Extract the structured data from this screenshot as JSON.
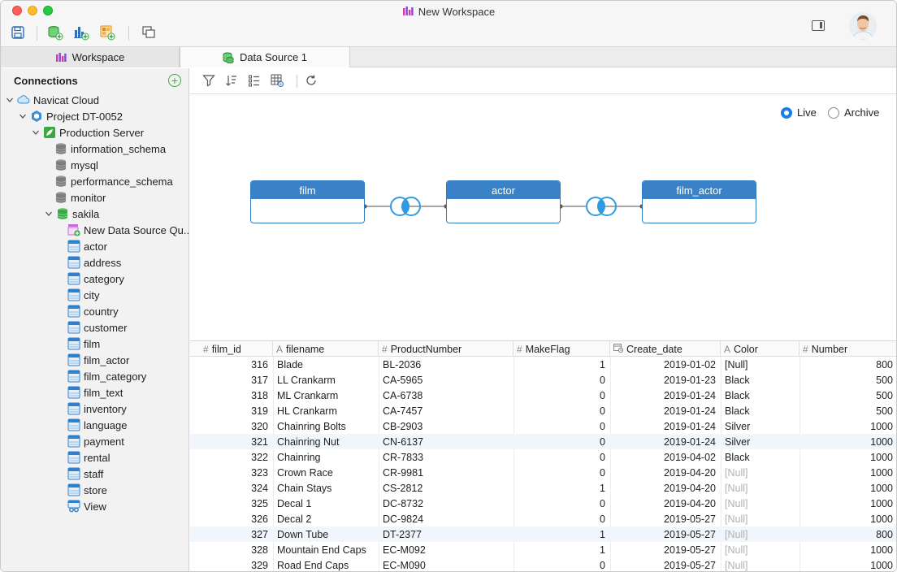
{
  "window": {
    "title": "New Workspace"
  },
  "toolbar": {
    "save_icon": "save-icon",
    "new_datasource_icon": "new-datasource-icon",
    "new_chart_icon": "new-chart-icon",
    "new_dashboard_icon": "new-dashboard-icon",
    "windows_icon": "windows-icon"
  },
  "tabs": [
    {
      "label": "Workspace",
      "icon": "workspace-icon"
    },
    {
      "label": "Data Source 1",
      "icon": "datasource-icon"
    }
  ],
  "sidebar": {
    "heading": "Connections",
    "add_symbol": "+",
    "tree": [
      {
        "label": "Navicat Cloud",
        "icon": "cloud-icon",
        "level": 0,
        "chevron": "open"
      },
      {
        "label": "Project DT-0052",
        "icon": "project-icon",
        "level": 1,
        "chevron": "open"
      },
      {
        "label": "Production Server",
        "icon": "server-icon",
        "level": 2,
        "chevron": "open"
      },
      {
        "label": "information_schema",
        "icon": "database-icon",
        "level": 3
      },
      {
        "label": "mysql",
        "icon": "database-icon",
        "level": 3
      },
      {
        "label": "performance_schema",
        "icon": "database-icon",
        "level": 3
      },
      {
        "label": "monitor",
        "icon": "database-icon",
        "level": 3
      },
      {
        "label": "sakila",
        "icon": "database-open-icon",
        "level": 3,
        "chevron": "open"
      },
      {
        "label": "New Data Source Qu...",
        "icon": "new-query-icon",
        "level": 4
      },
      {
        "label": "actor",
        "icon": "table-icon",
        "level": 4
      },
      {
        "label": "address",
        "icon": "table-icon",
        "level": 4
      },
      {
        "label": "category",
        "icon": "table-icon",
        "level": 4
      },
      {
        "label": "city",
        "icon": "table-icon",
        "level": 4
      },
      {
        "label": "country",
        "icon": "table-icon",
        "level": 4
      },
      {
        "label": "customer",
        "icon": "table-icon",
        "level": 4
      },
      {
        "label": "film",
        "icon": "table-icon",
        "level": 4
      },
      {
        "label": "film_actor",
        "icon": "table-icon",
        "level": 4
      },
      {
        "label": "film_category",
        "icon": "table-icon",
        "level": 4
      },
      {
        "label": "film_text",
        "icon": "table-icon",
        "level": 4
      },
      {
        "label": "inventory",
        "icon": "table-icon",
        "level": 4
      },
      {
        "label": "language",
        "icon": "table-icon",
        "level": 4
      },
      {
        "label": "payment",
        "icon": "table-icon",
        "level": 4
      },
      {
        "label": "rental",
        "icon": "table-icon",
        "level": 4
      },
      {
        "label": "staff",
        "icon": "table-icon",
        "level": 4
      },
      {
        "label": "store",
        "icon": "table-icon",
        "level": 4
      },
      {
        "label": "View",
        "icon": "view-icon",
        "level": 4
      }
    ]
  },
  "main_toolbar": {
    "filter_icon": "filter-icon",
    "sort_icon": "sort-icon",
    "fields_icon": "fields-icon",
    "table_settings_icon": "table-settings-icon",
    "refresh_icon": "refresh-icon"
  },
  "mode": {
    "options": [
      {
        "label": "Live",
        "selected": true
      },
      {
        "label": "Archive",
        "selected": false
      }
    ]
  },
  "diagram": {
    "entities": [
      {
        "name": "film"
      },
      {
        "name": "actor"
      },
      {
        "name": "film_actor"
      }
    ],
    "joins": [
      {
        "type": "inner-join-icon"
      },
      {
        "type": "inner-join-icon"
      }
    ]
  },
  "grid": {
    "columns": [
      {
        "name": "film_id",
        "type_icon": "#"
      },
      {
        "name": "filename",
        "type_icon": "A"
      },
      {
        "name": "ProductNumber",
        "type_icon": "#"
      },
      {
        "name": "MakeFlag",
        "type_icon": "#"
      },
      {
        "name": "Create_date",
        "type_icon": "date-icon"
      },
      {
        "name": "Color",
        "type_icon": "A"
      },
      {
        "name": "Number",
        "type_icon": "#"
      }
    ],
    "rows": [
      [
        "316",
        "Blade",
        "BL-2036",
        "1",
        "2019-01-02",
        "[Null]",
        "800"
      ],
      [
        "317",
        "LL Crankarm",
        "CA-5965",
        "0",
        "2019-01-23",
        "Black",
        "500"
      ],
      [
        "318",
        "ML Crankarm",
        "CA-6738",
        "0",
        "2019-01-24",
        "Black",
        "500"
      ],
      [
        "319",
        "HL Crankarm",
        "CA-7457",
        "0",
        "2019-01-24",
        "Black",
        "500"
      ],
      [
        "320",
        "Chainring Bolts",
        "CB-2903",
        "0",
        "2019-01-24",
        "Silver",
        "1000"
      ],
      [
        "321",
        "Chainring Nut",
        "CN-6137",
        "0",
        "2019-01-24",
        "Silver",
        "1000"
      ],
      [
        "322",
        "Chainring",
        "CR-7833",
        "0",
        "2019-04-02",
        "Black",
        "1000"
      ],
      [
        "323",
        "Crown Race",
        "CR-9981",
        "0",
        "2019-04-20",
        "[Null]",
        "1000"
      ],
      [
        "324",
        "Chain Stays",
        "CS-2812",
        "1",
        "2019-04-20",
        "[Null]",
        "1000"
      ],
      [
        "325",
        "Decal 1",
        "DC-8732",
        "0",
        "2019-04-20",
        "[Null]",
        "1000"
      ],
      [
        "326",
        "Decal 2",
        "DC-9824",
        "0",
        "2019-05-27",
        "[Null]",
        "1000"
      ],
      [
        "327",
        "Down Tube",
        "DT-2377",
        "1",
        "2019-05-27",
        "[Null]",
        "800"
      ],
      [
        "328",
        "Mountain End Caps",
        "EC-M092",
        "1",
        "2019-05-27",
        "[Null]",
        "1000"
      ],
      [
        "329",
        "Road End Caps",
        "EC-M090",
        "0",
        "2019-05-27",
        "[Null]",
        "1000"
      ]
    ]
  },
  "colors": {
    "accent": "#1a7ee6",
    "entity_header": "#3a82c7",
    "join_ring": "#2f9be0",
    "row_alt": "#f1f6fc",
    "null_text": "#b0b0b0"
  }
}
